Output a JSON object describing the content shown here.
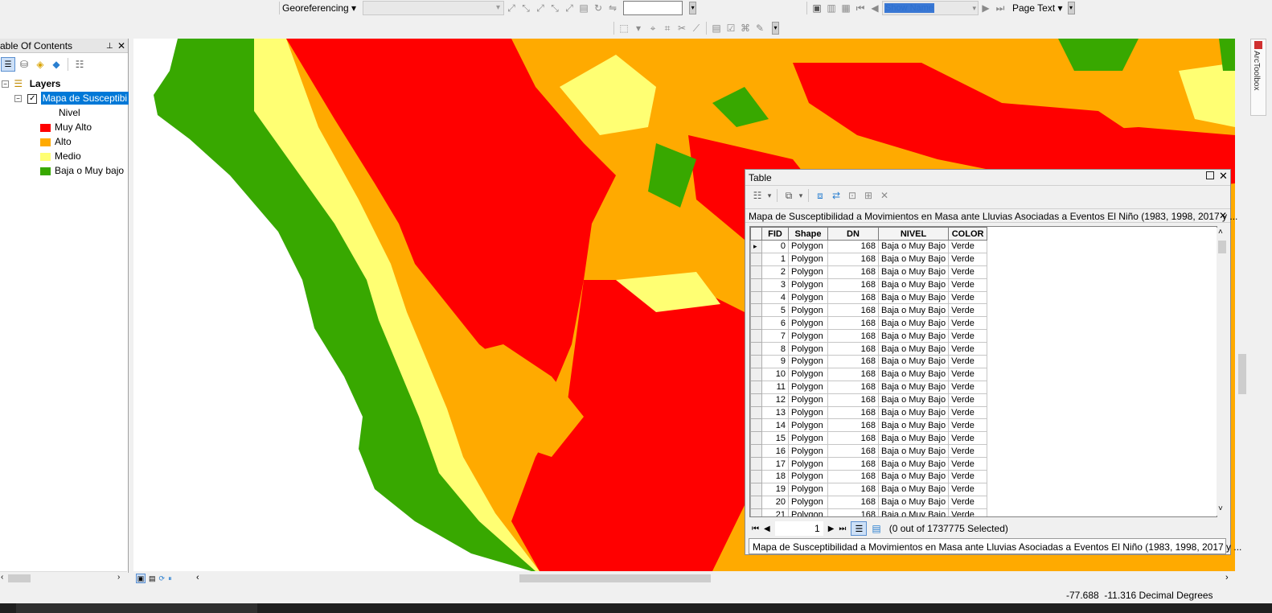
{
  "toolbar": {
    "georef_label": "Georeferencing",
    "show_name_value": "Show Name",
    "page_text_label": "Page Text"
  },
  "toc": {
    "title": "able Of Contents",
    "pin_glyph": "📌",
    "close_glyph": "✕",
    "root_label": "Layers",
    "layer_name": "Mapa de Susceptibi",
    "field_label": "Nivel",
    "legend": [
      {
        "label": "Muy Alto",
        "color": "#ff0000"
      },
      {
        "label": "Alto",
        "color": "#ffaa00"
      },
      {
        "label": "Medio",
        "color": "#ffff73"
      },
      {
        "label": "Baja o Muy bajo",
        "color": "#38a800"
      }
    ]
  },
  "table_window": {
    "title": "Table",
    "tab_title": "Mapa de Susceptibilidad a Movimientos en Masa ante Lluvias Asociadas a Eventos El Niño (1983, 1998, 2017 y ...",
    "columns": [
      "FID",
      "Shape",
      "DN",
      "NIVEL",
      "COLOR"
    ],
    "rows": [
      [
        "0",
        "Polygon",
        "168",
        "Baja o Muy Bajo",
        "Verde"
      ],
      [
        "1",
        "Polygon",
        "168",
        "Baja o Muy Bajo",
        "Verde"
      ],
      [
        "2",
        "Polygon",
        "168",
        "Baja o Muy Bajo",
        "Verde"
      ],
      [
        "3",
        "Polygon",
        "168",
        "Baja o Muy Bajo",
        "Verde"
      ],
      [
        "4",
        "Polygon",
        "168",
        "Baja o Muy Bajo",
        "Verde"
      ],
      [
        "5",
        "Polygon",
        "168",
        "Baja o Muy Bajo",
        "Verde"
      ],
      [
        "6",
        "Polygon",
        "168",
        "Baja o Muy Bajo",
        "Verde"
      ],
      [
        "7",
        "Polygon",
        "168",
        "Baja o Muy Bajo",
        "Verde"
      ],
      [
        "8",
        "Polygon",
        "168",
        "Baja o Muy Bajo",
        "Verde"
      ],
      [
        "9",
        "Polygon",
        "168",
        "Baja o Muy Bajo",
        "Verde"
      ],
      [
        "10",
        "Polygon",
        "168",
        "Baja o Muy Bajo",
        "Verde"
      ],
      [
        "11",
        "Polygon",
        "168",
        "Baja o Muy Bajo",
        "Verde"
      ],
      [
        "12",
        "Polygon",
        "168",
        "Baja o Muy Bajo",
        "Verde"
      ],
      [
        "13",
        "Polygon",
        "168",
        "Baja o Muy Bajo",
        "Verde"
      ],
      [
        "14",
        "Polygon",
        "168",
        "Baja o Muy Bajo",
        "Verde"
      ],
      [
        "15",
        "Polygon",
        "168",
        "Baja o Muy Bajo",
        "Verde"
      ],
      [
        "16",
        "Polygon",
        "168",
        "Baja o Muy Bajo",
        "Verde"
      ],
      [
        "17",
        "Polygon",
        "168",
        "Baja o Muy Bajo",
        "Verde"
      ],
      [
        "18",
        "Polygon",
        "168",
        "Baja o Muy Bajo",
        "Verde"
      ],
      [
        "19",
        "Polygon",
        "168",
        "Baja o Muy Bajo",
        "Verde"
      ],
      [
        "20",
        "Polygon",
        "168",
        "Baja o Muy Bajo",
        "Verde"
      ],
      [
        "21",
        "Polygon",
        "168",
        "Baja o Muy Bajo",
        "Verde"
      ]
    ],
    "record_value": "1",
    "selection_status": "(0 out of 1737775 Selected)",
    "bottom_tab": "Mapa de Susceptibilidad a Movimientos en Masa ante Lluvias Asociadas a Eventos El Niño (1983, 1998, 2017 y ..."
  },
  "arctoolbox_label": "ArcToolbox",
  "status": {
    "coords": "-77.688  -11.316 Decimal Degrees"
  }
}
